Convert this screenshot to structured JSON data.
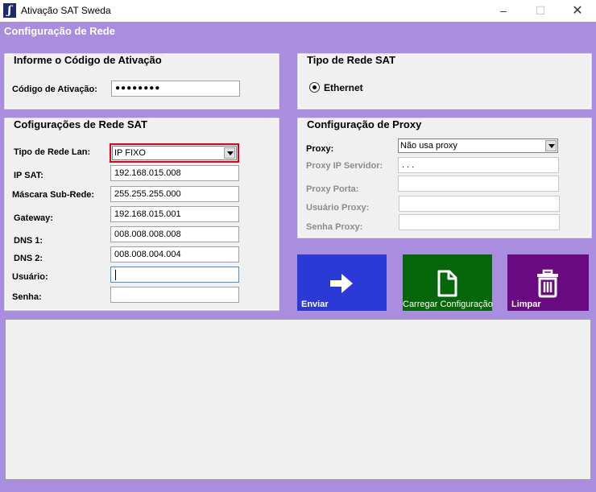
{
  "window": {
    "title": "Ativação SAT Sweda",
    "icon": "sweda-logo-icon"
  },
  "page_title": "Configuração de Rede",
  "activation": {
    "title": "Informe o Código de Ativação",
    "code_label": "Código de Ativação:",
    "code_value": "●●●●●●●●"
  },
  "sat_network_type": {
    "title": "Tipo de Rede SAT",
    "ethernet_label": "Ethernet",
    "ethernet_selected": true
  },
  "network": {
    "title": "Cofigurações de Rede SAT",
    "lan_type_label": "Tipo de Rede Lan:",
    "lan_type_value": "IP FIXO",
    "ip_label": "IP SAT:",
    "ip_value": "192.168.015.008",
    "mask_label": "Máscara Sub-Rede:",
    "mask_value": "255.255.255.000",
    "gateway_label": "Gateway:",
    "gateway_value": "192.168.015.001",
    "dns1_label": "DNS 1:",
    "dns1_value": "008.008.008.008",
    "dns2_label": "DNS 2:",
    "dns2_value": "008.008.004.004",
    "user_label": "Usuário:",
    "user_value": "",
    "password_label": "Senha:",
    "password_value": ""
  },
  "proxy": {
    "title": "Configuração de Proxy",
    "proxy_label": "Proxy:",
    "proxy_value": "Não usa proxy",
    "server_label": "Proxy IP Servidor:",
    "server_value": " .  .  .",
    "port_label": "Proxy Porta:",
    "port_value": "",
    "user_label": "Usuário Proxy:",
    "user_value": "",
    "password_label": "Senha Proxy:",
    "password_value": ""
  },
  "actions": {
    "send_label": "Enviar",
    "load_label": "Carregar Configuração",
    "clear_label": "Limpar"
  },
  "colors": {
    "background": "#a98ee0",
    "send_tile": "#2b3ad6",
    "load_tile": "#06670a",
    "clear_tile": "#6a0a82",
    "highlight": "#e0001b"
  }
}
